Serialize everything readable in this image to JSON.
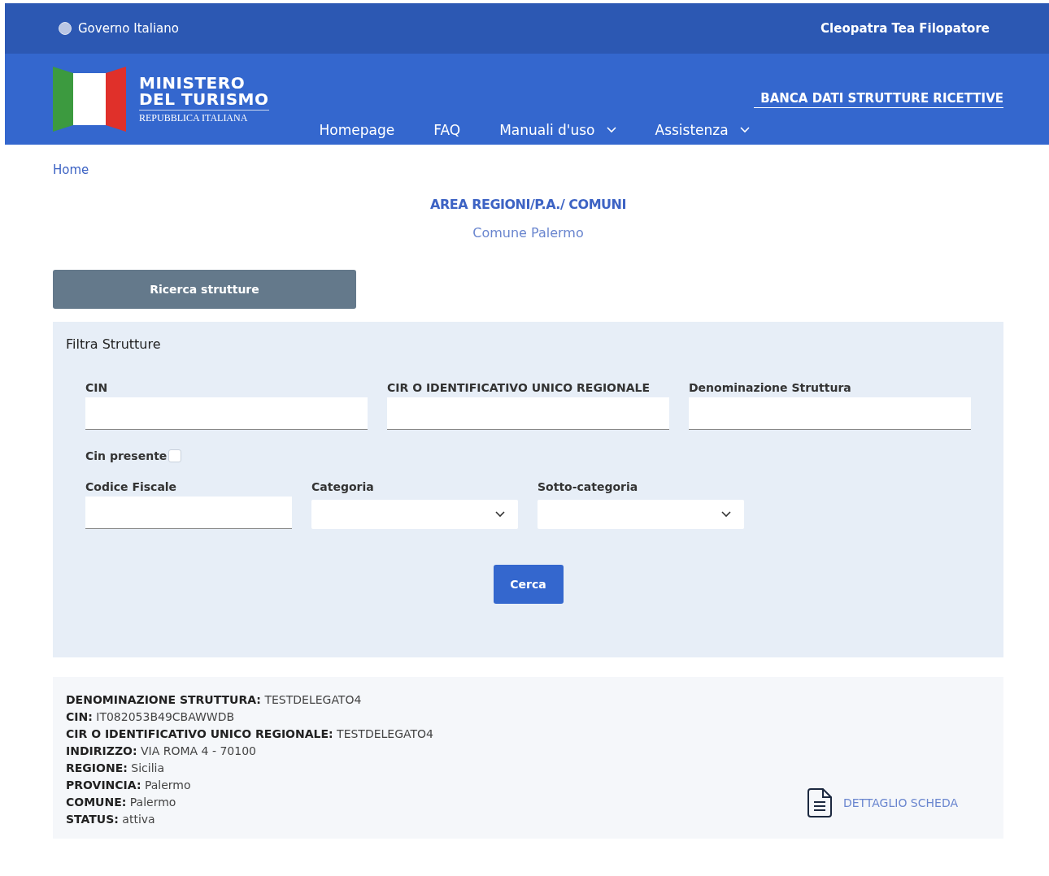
{
  "top_bar": {
    "government_link": "Governo Italiano",
    "user_name": "Cleopatra Tea Filopatore"
  },
  "header": {
    "logo_title_1": "MINISTERO",
    "logo_title_2": "DEL TURISMO",
    "logo_subtitle": "REPUBBLICA ITALIANA",
    "site_title": "BANCA DATI STRUTTURE RICETTIVE",
    "nav": [
      {
        "label": "Homepage",
        "dropdown": false
      },
      {
        "label": "FAQ",
        "dropdown": false
      },
      {
        "label": "Manuali d'uso",
        "dropdown": true
      },
      {
        "label": "Assistenza",
        "dropdown": true
      }
    ]
  },
  "breadcrumb": "Home",
  "area_title": "AREA REGIONI/P.A./ COMUNI",
  "area_subtitle": "Comune Palermo",
  "tab_button": "Ricerca strutture",
  "filter": {
    "title": "Filtra Strutture",
    "row_1": [
      {
        "kind": "text",
        "label": "CIN"
      },
      {
        "kind": "text",
        "label": "CIR O IDENTIFICATIVO UNICO REGIONALE"
      },
      {
        "kind": "text",
        "label": "Denominazione Struttura"
      }
    ],
    "checkbox": {
      "label": "Cin presente",
      "checked": false
    },
    "row_2": [
      {
        "kind": "text",
        "label": "Codice Fiscale"
      },
      {
        "kind": "select",
        "label": "Categoria"
      },
      {
        "kind": "select",
        "label": "Sotto-categoria"
      }
    ],
    "search_button": "Cerca"
  },
  "result": {
    "lines": [
      "**DENOMINAZIONE STRUTTURA:** TESTDELEGATO4",
      "**CIN:** IT082053B49CBAWWDB",
      "**CIR O IDENTIFICATIVO UNICO REGIONALE:** TESTDELEGATO4",
      "**INDIRIZZO:** VIA ROMA 4 - 70100",
      "**REGIONE:** Sicilia",
      "**PROVINCIA:** Palermo",
      "**COMUNE:** Palermo",
      "**STATUS:** attiva"
    ],
    "detail_link": "DETTAGLIO SCHEDA"
  }
}
